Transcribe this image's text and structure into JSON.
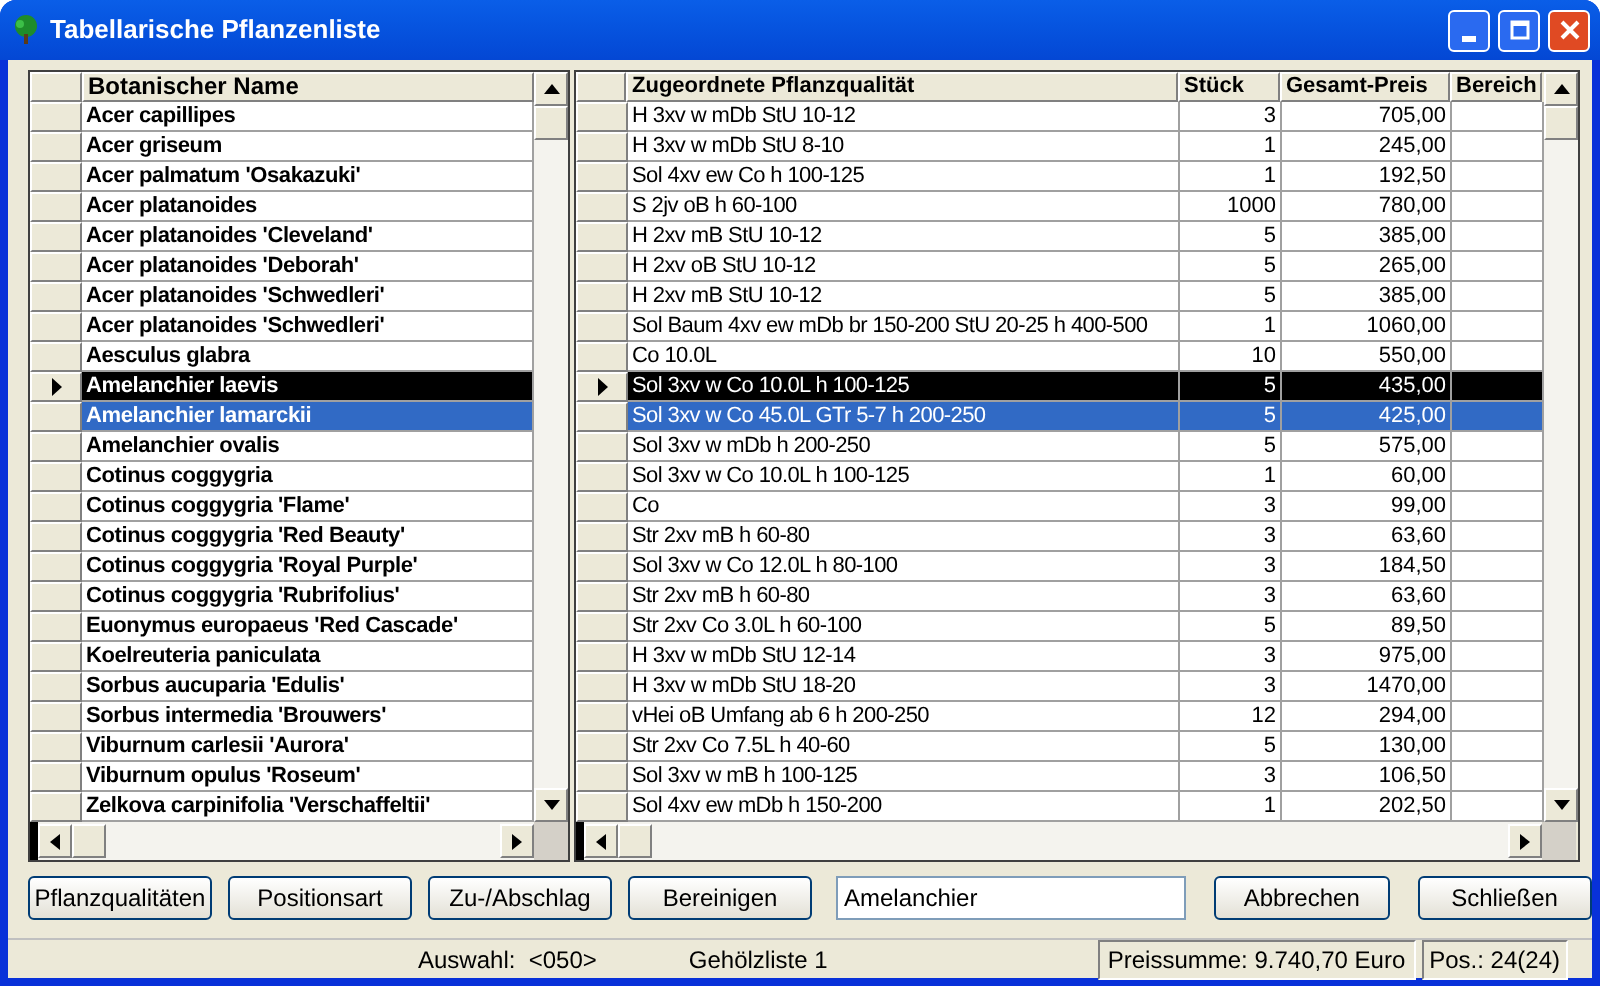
{
  "window": {
    "title": "Tabellarische Pflanzenliste"
  },
  "plant_grid": {
    "columns": [
      "Botanischer Name"
    ]
  },
  "quality_grid": {
    "columns": [
      "Zugeordnete Pflanzqualität",
      "Stück",
      "Gesamt-Preis",
      "Bereich"
    ]
  },
  "rows": [
    {
      "name": "Acer capillipes",
      "quality": "H 3xv w mDb StU 10-12",
      "count": "3",
      "price": "705,00",
      "current": false,
      "selected": false
    },
    {
      "name": "Acer griseum",
      "quality": "H 3xv w mDb StU 8-10",
      "count": "1",
      "price": "245,00",
      "current": false,
      "selected": false
    },
    {
      "name": "Acer palmatum 'Osakazuki'",
      "quality": "Sol 4xv ew Co h 100-125",
      "count": "1",
      "price": "192,50",
      "current": false,
      "selected": false
    },
    {
      "name": "Acer platanoides",
      "quality": "S 2jv oB h 60-100",
      "count": "1000",
      "price": "780,00",
      "current": false,
      "selected": false
    },
    {
      "name": "Acer platanoides 'Cleveland'",
      "quality": "H 2xv mB StU 10-12",
      "count": "5",
      "price": "385,00",
      "current": false,
      "selected": false
    },
    {
      "name": "Acer platanoides 'Deborah'",
      "quality": "H 2xv oB StU 10-12",
      "count": "5",
      "price": "265,00",
      "current": false,
      "selected": false
    },
    {
      "name": "Acer platanoides 'Schwedleri'",
      "quality": "H 2xv mB StU 10-12",
      "count": "5",
      "price": "385,00",
      "current": false,
      "selected": false
    },
    {
      "name": "Acer platanoides 'Schwedleri'",
      "quality": "Sol Baum 4xv ew mDb br 150-200 StU 20-25 h 400-500",
      "count": "1",
      "price": "1060,00",
      "current": false,
      "selected": false
    },
    {
      "name": "Aesculus glabra",
      "quality": "Co 10.0L",
      "count": "10",
      "price": "550,00",
      "current": false,
      "selected": false
    },
    {
      "name": "Amelanchier laevis",
      "quality": "Sol 3xv w Co 10.0L h 100-125",
      "count": "5",
      "price": "435,00",
      "current": true,
      "selected": false
    },
    {
      "name": "Amelanchier lamarckii",
      "quality": "Sol 3xv w Co 45.0L GTr 5-7 h 200-250",
      "count": "5",
      "price": "425,00",
      "current": false,
      "selected": true
    },
    {
      "name": "Amelanchier ovalis",
      "quality": "Sol 3xv w mDb h 200-250",
      "count": "5",
      "price": "575,00",
      "current": false,
      "selected": false
    },
    {
      "name": "Cotinus coggygria",
      "quality": "Sol 3xv w Co 10.0L h 100-125",
      "count": "1",
      "price": "60,00",
      "current": false,
      "selected": false
    },
    {
      "name": "Cotinus coggygria 'Flame'",
      "quality": "Co",
      "count": "3",
      "price": "99,00",
      "current": false,
      "selected": false
    },
    {
      "name": "Cotinus coggygria 'Red Beauty'",
      "quality": "Str 2xv mB h 60-80",
      "count": "3",
      "price": "63,60",
      "current": false,
      "selected": false
    },
    {
      "name": "Cotinus coggygria 'Royal Purple'",
      "quality": "Sol 3xv w Co 12.0L h 80-100",
      "count": "3",
      "price": "184,50",
      "current": false,
      "selected": false
    },
    {
      "name": "Cotinus coggygria 'Rubrifolius'",
      "quality": "Str 2xv mB h 60-80",
      "count": "3",
      "price": "63,60",
      "current": false,
      "selected": false
    },
    {
      "name": "Euonymus europaeus 'Red Cascade'",
      "quality": "Str 2xv Co 3.0L h 60-100",
      "count": "5",
      "price": "89,50",
      "current": false,
      "selected": false
    },
    {
      "name": "Koelreuteria paniculata",
      "quality": "H 3xv w mDb StU 12-14",
      "count": "3",
      "price": "975,00",
      "current": false,
      "selected": false
    },
    {
      "name": "Sorbus aucuparia 'Edulis'",
      "quality": "H 3xv w mDb StU 18-20",
      "count": "3",
      "price": "1470,00",
      "current": false,
      "selected": false
    },
    {
      "name": "Sorbus intermedia 'Brouwers'",
      "quality": "vHei oB Umfang ab 6 h 200-250",
      "count": "12",
      "price": "294,00",
      "current": false,
      "selected": false
    },
    {
      "name": "Viburnum carlesii 'Aurora'",
      "quality": "Str 2xv Co 7.5L h 40-60",
      "count": "5",
      "price": "130,00",
      "current": false,
      "selected": false
    },
    {
      "name": "Viburnum opulus 'Roseum'",
      "quality": "Sol 3xv w mB h 100-125",
      "count": "3",
      "price": "106,50",
      "current": false,
      "selected": false
    },
    {
      "name": "Zelkova carpinifolia 'Verschaffeltii'",
      "quality": "Sol 4xv ew mDb h 150-200",
      "count": "1",
      "price": "202,50",
      "current": false,
      "selected": false
    }
  ],
  "buttons_left": [
    "Pflanzqualitäten",
    "Positionsart",
    "Zu-/Abschlag",
    "Bereinigen"
  ],
  "search": {
    "value": "Amelanchier"
  },
  "buttons_right": [
    "Abbrechen",
    "Schließen"
  ],
  "status_bar": {
    "selection": "Auswahl:  <050>",
    "list": "Gehölzliste 1",
    "total": "Preissumme: 9.740,70 Euro",
    "position": "Pos.: 24(24)"
  }
}
